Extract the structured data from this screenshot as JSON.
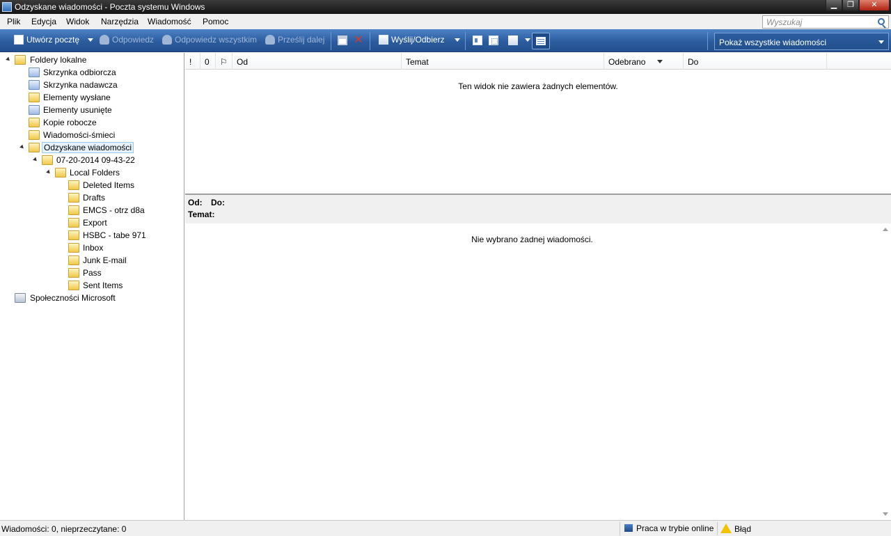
{
  "window": {
    "title": "Odzyskane wiadomości - Poczta systemu Windows",
    "minimize_glyph": "▁",
    "maximize_glyph": "❐",
    "close_glyph": "✕"
  },
  "menu": [
    "Plik",
    "Edycja",
    "Widok",
    "Narzędzia",
    "Wiadomość",
    "Pomoc"
  ],
  "search": {
    "placeholder": "Wyszukaj"
  },
  "toolbar": {
    "compose": "Utwórz pocztę",
    "reply": "Odpowiedz",
    "reply_all": "Odpowiedz wszystkim",
    "forward": "Prześlij dalej",
    "send_receive": "Wyślij/Odbierz",
    "delete_glyph": "✕",
    "view_filter": "Pokaż wszystkie wiadomości"
  },
  "folders": [
    {
      "label": "Foldery lokalne",
      "icon": "local-folders-icon"
    },
    {
      "label": "Skrzynka odbiorcza",
      "icon": "inbox-icon"
    },
    {
      "label": "Skrzynka nadawcza",
      "icon": "outbox-icon"
    },
    {
      "label": "Elementy wysłane",
      "icon": "sent-icon"
    },
    {
      "label": "Elementy usunięte",
      "icon": "trash-icon"
    },
    {
      "label": "Kopie robocze",
      "icon": "drafts-icon"
    },
    {
      "label": "Wiadomości-śmieci",
      "icon": "junk-icon"
    },
    {
      "label": "Odzyskane wiadomości",
      "icon": "folder-icon",
      "selected": true
    },
    {
      "label": "07-20-2014 09-43-22",
      "icon": "folder-icon"
    },
    {
      "label": "Local Folders",
      "icon": "folder-icon"
    },
    {
      "label": "Deleted Items",
      "icon": "folder-icon"
    },
    {
      "label": "Drafts",
      "icon": "folder-icon"
    },
    {
      "label": "EMCS - otrz d8a",
      "icon": "folder-icon"
    },
    {
      "label": "Export",
      "icon": "folder-icon"
    },
    {
      "label": "HSBC - tabe 971",
      "icon": "folder-icon"
    },
    {
      "label": "Inbox",
      "icon": "folder-icon"
    },
    {
      "label": "Junk E-mail",
      "icon": "folder-icon"
    },
    {
      "label": "Pass",
      "icon": "folder-icon"
    },
    {
      "label": "Sent Items",
      "icon": "folder-icon"
    },
    {
      "label": "Społeczności Microsoft",
      "icon": "communities-icon"
    }
  ],
  "list": {
    "columns": {
      "priority": "!",
      "attachment": "0",
      "flag": "⚐",
      "from": "Od",
      "subject": "Temat",
      "received": "Odebrano",
      "to": "Do"
    },
    "empty_text": "Ten widok nie zawiera żadnych elementów."
  },
  "preview": {
    "from_label": "Od:",
    "to_label": "Do:",
    "subject_label": "Temat:",
    "empty_text": "Nie wybrano żadnej wiadomości."
  },
  "status": {
    "messages": "Wiadomości: 0, nieprzeczytane: 0",
    "online": "Praca w trybie online",
    "error": "Błąd"
  }
}
